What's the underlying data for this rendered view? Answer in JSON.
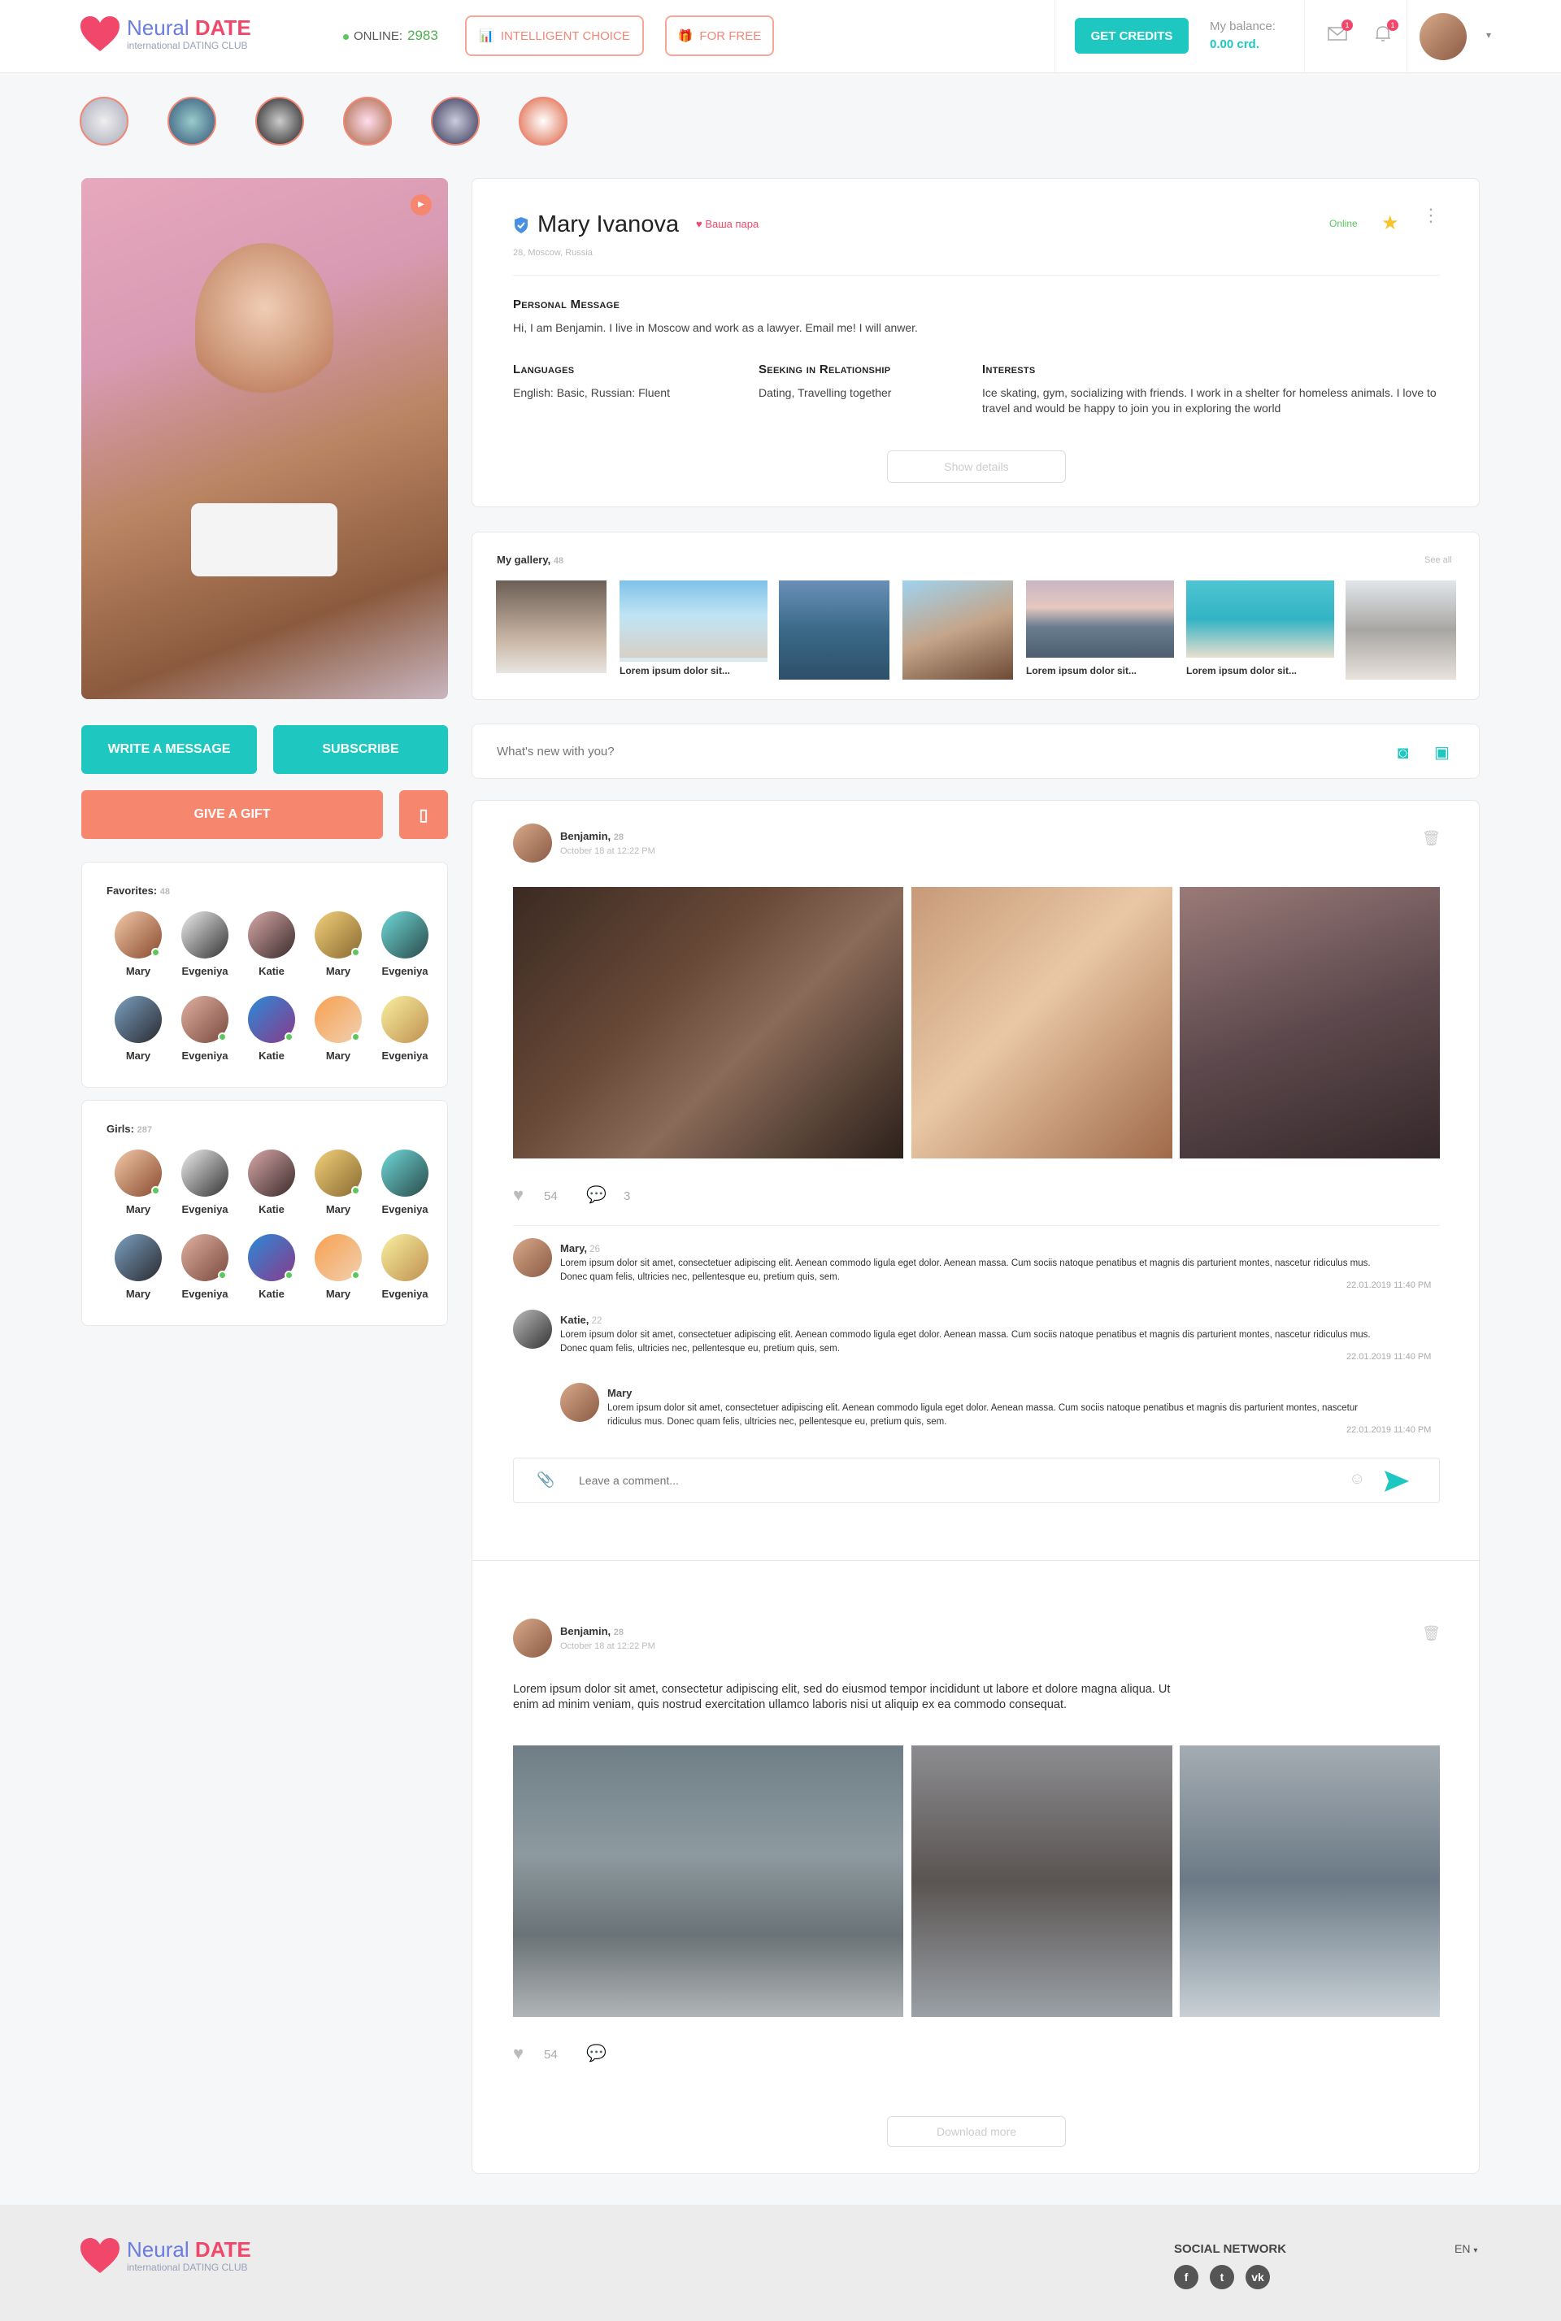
{
  "brand": {
    "name_a": "Neural ",
    "name_b": "DATE",
    "tagline": "international DATING CLUB"
  },
  "header": {
    "online_label": "ONLINE:",
    "online_count": "2983",
    "intelligent_choice": "INTELLIGENT CHOICE",
    "for_free": "FOR FREE",
    "get_credits": "GET CREDITS",
    "balance_label": "My balance:",
    "balance_value": "0.00 crd.",
    "mail_badge": "1",
    "bell_badge": "1"
  },
  "profile": {
    "name": "Mary Ivanova",
    "match": "Ваша пара",
    "meta": "28, Moscow, Russia",
    "status": "Online",
    "personal_h": "Personal Message",
    "personal_t": "Hi, I am Benjamin. I live in Moscow and work as a lawyer. Email me! I will anwer.",
    "languages_h": "Languages",
    "languages_t": "English: Basic,  Russian: Fluent",
    "seeking_h": "Seeking in Relationship",
    "seeking_t": "Dating, Travelling together",
    "interests_h": "Interests",
    "interests_t": "Ice skating, gym, socializing with friends. I work in a shelter for homeless animals. I love to travel and would be happy to join you in exploring the world",
    "show_details": "Show details"
  },
  "gallery": {
    "title": "My gallery,",
    "count": "48",
    "see_all": "See all",
    "captions": [
      "",
      "Lorem ipsum dolor sit...",
      "",
      "",
      "Lorem ipsum dolor sit...",
      "Lorem ipsum dolor sit...",
      ""
    ]
  },
  "actions": {
    "write": "WRITE A MESSAGE",
    "subscribe": "SUBSCRIBE",
    "gift": "GIVE A GIFT"
  },
  "favorites": {
    "title": "Favorites:",
    "count": "48",
    "people": [
      "Mary",
      "Evgeniya",
      "Katie",
      "Mary",
      "Evgeniya",
      "Mary",
      "Evgeniya",
      "Katie",
      "Mary",
      "Evgeniya"
    ]
  },
  "girls": {
    "title": "Girls:",
    "count": "287",
    "people": [
      "Mary",
      "Evgeniya",
      "Katie",
      "Mary",
      "Evgeniya",
      "Mary",
      "Evgeniya",
      "Katie",
      "Mary",
      "Evgeniya"
    ]
  },
  "composer": {
    "placeholder": "What's new with you?"
  },
  "post1": {
    "author": "Benjamin,",
    "age": "28",
    "date": "October 18 at 12:22 PM",
    "likes": "54",
    "comments": "3",
    "c1_author": "Mary,",
    "c1_age": "26",
    "c1_text": "Lorem ipsum dolor sit amet, consectetuer adipiscing elit. Aenean commodo ligula eget dolor. Aenean massa. Cum sociis natoque penatibus et magnis dis parturient montes, nascetur ridiculus mus. Donec quam felis, ultricies nec, pellentesque eu, pretium quis, sem.",
    "c1_time": "22.01.2019 11:40 PM",
    "c2_author": "Katie,",
    "c2_age": "22",
    "c2_text": "Lorem ipsum dolor sit amet, consectetuer adipiscing elit. Aenean commodo ligula eget dolor. Aenean massa. Cum sociis natoque penatibus et magnis dis parturient montes, nascetur ridiculus mus. Donec quam felis, ultricies nec, pellentesque eu, pretium quis, sem.",
    "c2_time": "22.01.2019 11:40 PM",
    "c3_author": "Mary",
    "c3_text": "Lorem ipsum dolor sit amet, consectetuer adipiscing elit. Aenean commodo ligula eget dolor. Aenean massa. Cum sociis natoque penatibus et magnis dis parturient montes, nascetur ridiculus mus. Donec quam felis, ultricies nec, pellentesque eu, pretium quis, sem.",
    "c3_time": "22.01.2019 11:40 PM",
    "comment_placeholder": "Leave a comment..."
  },
  "post2": {
    "author": "Benjamin,",
    "age": "28",
    "date": "October 18 at 12:22 PM",
    "text": "Lorem ipsum dolor sit amet, consectetur adipiscing elit, sed do eiusmod tempor incididunt ut labore et dolore magna aliqua. Ut enim ad minim veniam, quis nostrud exercitation ullamco laboris nisi ut aliquip ex ea commodo consequat.",
    "likes": "54"
  },
  "download_more": "Download more",
  "footer": {
    "social": "SOCIAL NETWORK",
    "lang": "EN"
  },
  "colors": {
    "accent": "#1ec8c0",
    "coral": "#f7866f",
    "brand_pink": "#f0476a",
    "brand_blue": "#6a7ce0"
  }
}
